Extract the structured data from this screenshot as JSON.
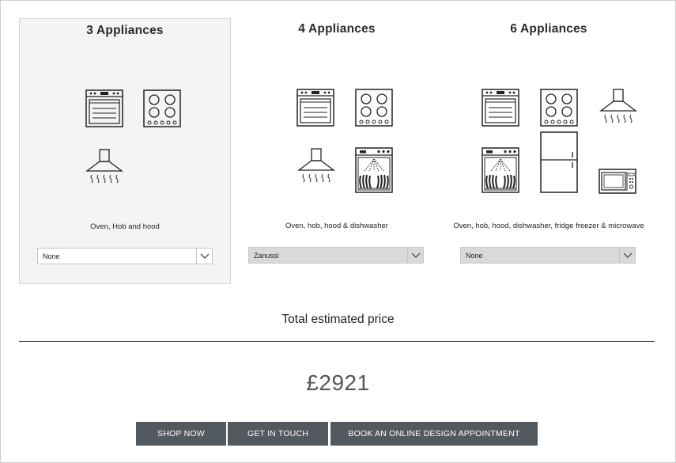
{
  "packages": [
    {
      "title": "3 Appliances",
      "description": "Oven, Hob and hood",
      "selected_option": "None",
      "selected": true
    },
    {
      "title": "4 Appliances",
      "description": "Oven, hob, hood & dishwasher",
      "selected_option": "Zanussi",
      "selected": false
    },
    {
      "title": "6 Appliances",
      "description": "Oven, hob, hood, dishwasher, fridge freezer & microwave",
      "selected_option": "None",
      "selected": false
    }
  ],
  "appliance_icons": [
    "oven-icon",
    "hob-icon",
    "hood-icon",
    "dishwasher-icon",
    "fridge-freezer-icon",
    "microwave-icon"
  ],
  "total": {
    "label": "Total estimated price",
    "price": "£2921"
  },
  "actions": {
    "shop_now": "SHOP NOW",
    "get_in_touch": "GET IN TOUCH",
    "book_appointment": "BOOK AN ONLINE DESIGN APPOINTMENT"
  },
  "colors": {
    "button_bg": "#525a60",
    "selected_card_bg": "#f4f4f4",
    "select_grey_bg": "#d9d9d9"
  }
}
